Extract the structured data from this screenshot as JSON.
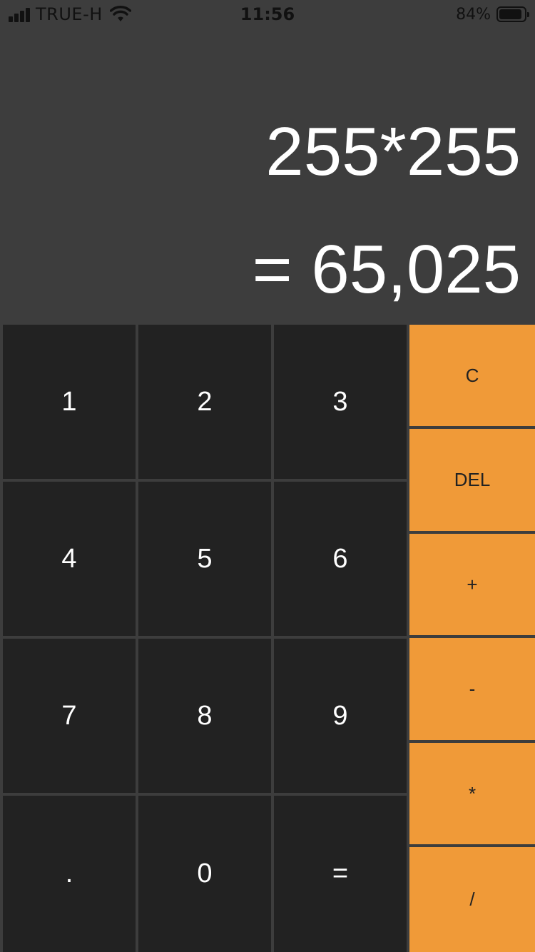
{
  "status_bar": {
    "carrier": "TRUE-H",
    "time": "11:56",
    "battery_percent": "84%"
  },
  "display": {
    "expression": "255*255",
    "result": "= 65,025"
  },
  "keypad": {
    "digits": {
      "one": "1",
      "two": "2",
      "three": "3",
      "four": "4",
      "five": "5",
      "six": "6",
      "seven": "7",
      "eight": "8",
      "nine": "9",
      "dot": ".",
      "zero": "0",
      "equals": "="
    },
    "operators": {
      "clear": "C",
      "delete": "DEL",
      "plus": "+",
      "minus": "-",
      "multiply": "*",
      "divide": "/"
    }
  },
  "colors": {
    "background": "#3d3d3d",
    "key": "#222222",
    "operator": "#f09a38"
  }
}
